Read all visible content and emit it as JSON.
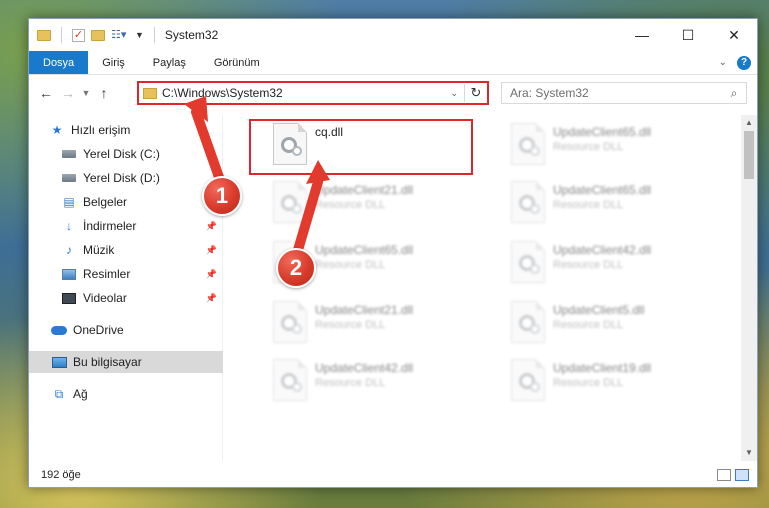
{
  "window": {
    "title": "System32"
  },
  "ribbon": {
    "tabs": [
      "Dosya",
      "Giriş",
      "Paylaş",
      "Görünüm"
    ],
    "help": "?"
  },
  "address": {
    "path": "C:\\Windows\\System32",
    "search_placeholder": "Ara: System32"
  },
  "sidebar": {
    "items": [
      {
        "label": "Hızlı erişim",
        "icon": "star-icon"
      },
      {
        "label": "Yerel Disk (C:)",
        "icon": "drive-icon"
      },
      {
        "label": "Yerel Disk (D:)",
        "icon": "drive-icon"
      },
      {
        "label": "Belgeler",
        "icon": "document-icon"
      },
      {
        "label": "İndirmeler",
        "icon": "download-icon"
      },
      {
        "label": "Müzik",
        "icon": "music-icon"
      },
      {
        "label": "Resimler",
        "icon": "pictures-icon"
      },
      {
        "label": "Videolar",
        "icon": "video-icon"
      },
      {
        "label": "OneDrive",
        "icon": "cloud-icon"
      },
      {
        "label": "Bu bilgisayar",
        "icon": "computer-icon"
      },
      {
        "label": "Ağ",
        "icon": "network-icon"
      }
    ]
  },
  "files": [
    {
      "name": "cq.dll",
      "type": ""
    },
    {
      "name": "UpdateClient65.dll",
      "type": "Resource DLL"
    },
    {
      "name": "UpdateClient21.dll",
      "type": "Resource DLL"
    },
    {
      "name": "UpdateClient65.dll",
      "type": "Resource DLL"
    },
    {
      "name": "UpdateClient65.dll",
      "type": "Resource DLL"
    },
    {
      "name": "UpdateClient42.dll",
      "type": "Resource DLL"
    },
    {
      "name": "UpdateClient21.dll",
      "type": "Resource DLL"
    },
    {
      "name": "UpdateClient5.dll",
      "type": "Resource DLL"
    },
    {
      "name": "UpdateClient42.dll",
      "type": "Resource DLL"
    },
    {
      "name": "UpdateClient19.dll",
      "type": "Resource DLL"
    }
  ],
  "status": {
    "count": "192 öğe"
  },
  "markers": [
    "1",
    "2"
  ],
  "colors": {
    "accent": "#1979ca",
    "highlight": "#e0262a",
    "selected": "#d9d9d9"
  }
}
